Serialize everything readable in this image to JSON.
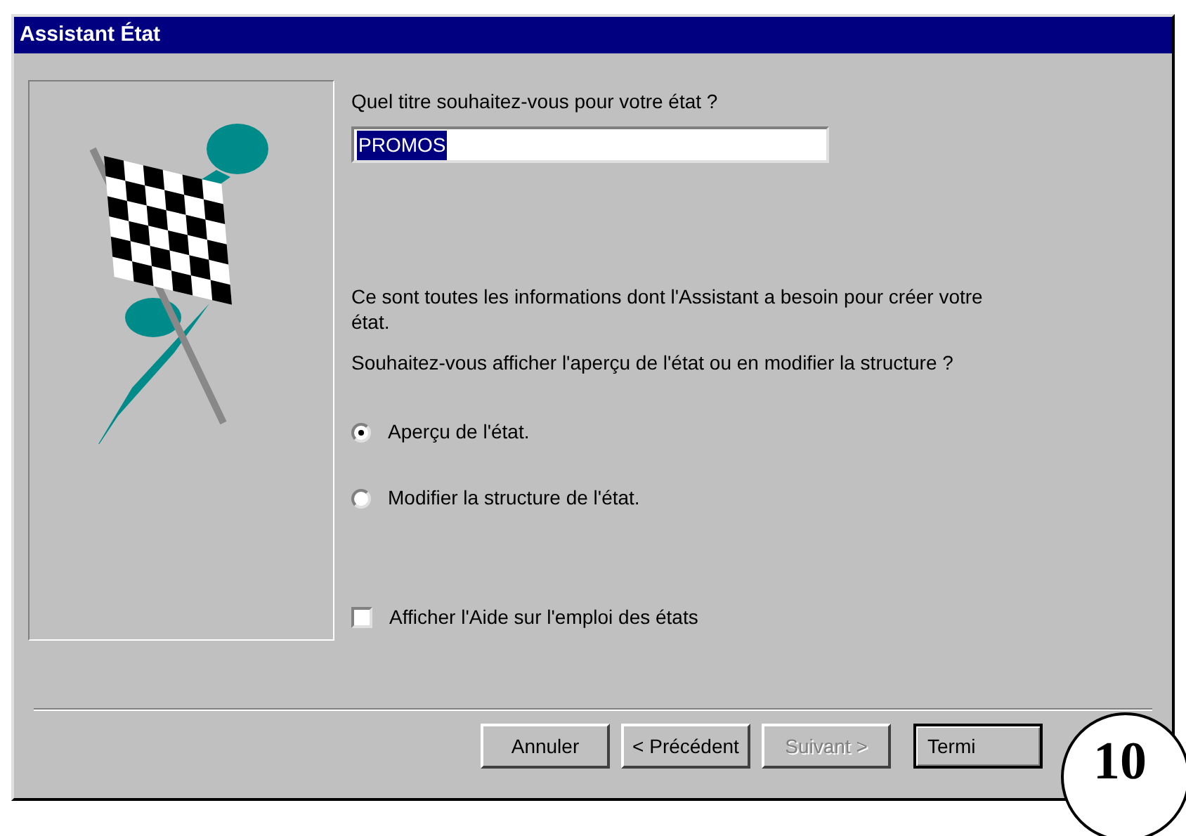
{
  "window": {
    "title": "Assistant État"
  },
  "title_prompt": "Quel titre souhaitez-vous pour votre état ?",
  "title_field": {
    "value": "PROMOS"
  },
  "info": "Ce sont toutes les informations dont l'Assistant a besoin pour créer votre état.",
  "question": "Souhaitez-vous afficher l'aperçu de l'état ou en modifier la structure ?",
  "options": [
    {
      "label": "Aperçu de l'état.",
      "selected": true
    },
    {
      "label": "Modifier la structure de l'état.",
      "selected": false
    }
  ],
  "help_checkbox": {
    "label": "Afficher l'Aide sur l'emploi des états",
    "checked": false
  },
  "buttons": [
    {
      "label": "Annuler",
      "disabled": false,
      "default": false
    },
    {
      "label": "< Précédent",
      "disabled": false,
      "default": false
    },
    {
      "label": "Suivant >",
      "disabled": true,
      "default": false
    },
    {
      "label": "Termi",
      "disabled": false,
      "default": true
    }
  ],
  "step_badge": "10"
}
